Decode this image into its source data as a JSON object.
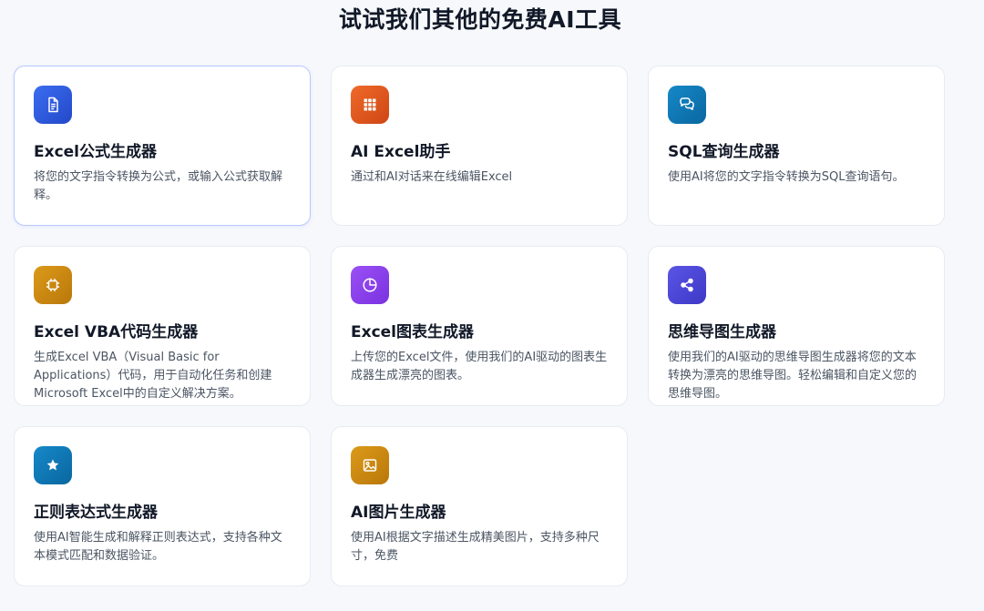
{
  "page": {
    "title": "试试我们其他的免费AI工具"
  },
  "tools": [
    {
      "title": "Excel公式生成器",
      "description": "将您的文字指令转换为公式，或输入公式获取解释。",
      "icon": "document-icon",
      "color": "#2f5fe0"
    },
    {
      "title": "AI Excel助手",
      "description": "通过和AI对话来在线编辑Excel",
      "icon": "grid-icon",
      "color": "#e0561f"
    },
    {
      "title": "SQL查询生成器",
      "description": "使用AI将您的文字指令转换为SQL查询语句。",
      "icon": "chat-bubbles-icon",
      "color": "#0b79b8"
    },
    {
      "title": "Excel VBA代码生成器",
      "description": "生成Excel VBA（Visual Basic for Applications）代码，用于自动化任务和创建Microsoft Excel中的自定义解决方案。",
      "icon": "chip-icon",
      "color": "#d08a10"
    },
    {
      "title": "Excel图表生成器",
      "description": "上传您的Excel文件，使用我们的AI驱动的图表生成器生成漂亮的图表。",
      "icon": "pie-chart-icon",
      "color": "#8a3ff0"
    },
    {
      "title": "思维导图生成器",
      "description": "使用我们的AI驱动的思维导图生成器将您的文本转换为漂亮的思维导图。轻松编辑和自定义您的思维导图。",
      "icon": "share-icon",
      "color": "#4b46d6"
    },
    {
      "title": "正则表达式生成器",
      "description": "使用AI智能生成和解释正则表达式，支持各种文本模式匹配和数据验证。",
      "icon": "star-icon",
      "color": "#0b79b8"
    },
    {
      "title": "AI图片生成器",
      "description": "使用AI根据文字描述生成精美图片，支持多种尺寸，免费",
      "icon": "image-icon",
      "color": "#d08a10"
    }
  ]
}
